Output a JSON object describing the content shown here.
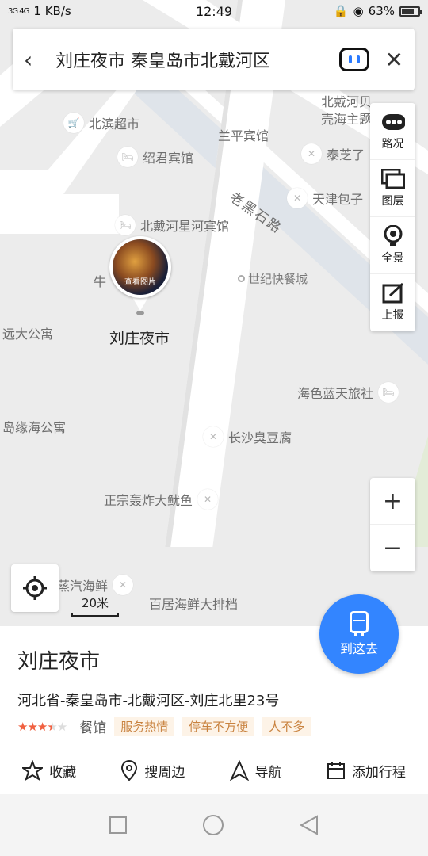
{
  "status_bar": {
    "network": "3G 4G",
    "speed": "1 KB/s",
    "time": "12:49",
    "battery": "63%"
  },
  "search": {
    "query": "刘庄夜市 秦皇岛市北戴河区"
  },
  "tools": [
    {
      "label": "路况",
      "icon": "traffic-icon"
    },
    {
      "label": "图层",
      "icon": "layers-icon"
    },
    {
      "label": "全景",
      "icon": "panorama-icon"
    },
    {
      "label": "上报",
      "icon": "report-icon"
    }
  ],
  "map": {
    "road_label": "老黑石路",
    "pois": [
      {
        "text": "北滨超市"
      },
      {
        "text": "兰平宾馆"
      },
      {
        "text": "绍君宾馆"
      },
      {
        "text": "泰芝了"
      },
      {
        "text": "天津包子"
      },
      {
        "text": "北戴河星河宾馆"
      },
      {
        "text": "远大公寓"
      },
      {
        "text": "海色蓝天旅社"
      },
      {
        "text": "岛缘海公寓"
      },
      {
        "text": "长沙臭豆腐"
      },
      {
        "text": "正宗轰炸大鱿鱼"
      },
      {
        "text": "蒸汽海鲜"
      },
      {
        "text": "百居海鲜大排档"
      },
      {
        "text": "北戴河贝壳海主题"
      },
      {
        "text": "牛"
      }
    ],
    "small_label": "世纪快餐城",
    "marker_photo_text": "查看图片",
    "marker_label": "刘庄夜市",
    "scale": "20米",
    "accent": "#3385ff"
  },
  "zoom": {
    "in": "+",
    "out": "−"
  },
  "go_button": {
    "label": "到这去"
  },
  "place": {
    "name": "刘庄夜市",
    "address": "河北省-秦皇岛市-北戴河区-刘庄北里23号",
    "rating": 3.5,
    "category": "餐馆",
    "tags": [
      "服务热情",
      "停车不方便",
      "人不多"
    ]
  },
  "actions": [
    {
      "label": "收藏",
      "icon": "star-outline-icon"
    },
    {
      "label": "搜周边",
      "icon": "location-pin-icon"
    },
    {
      "label": "导航",
      "icon": "navigation-arrow-icon"
    },
    {
      "label": "添加行程",
      "icon": "calendar-icon"
    }
  ]
}
